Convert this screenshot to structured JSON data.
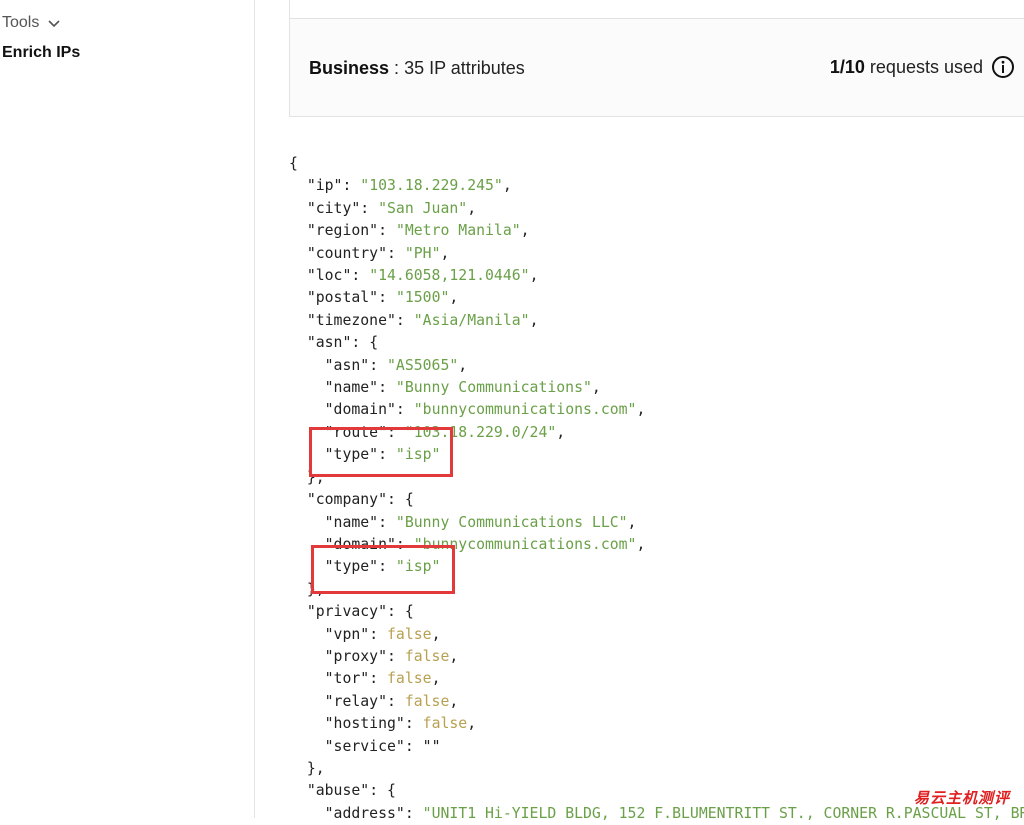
{
  "sidebar": {
    "section_label": "Tools",
    "items": [
      {
        "label": "Enrich IPs"
      }
    ]
  },
  "plan": {
    "tier": "Business",
    "separator": " : ",
    "attributes": "35 IP attributes",
    "requests_used_count": "1/10",
    "requests_used_label": "requests used"
  },
  "json_lines": [
    [
      [
        "p",
        "{"
      ]
    ],
    [
      [
        "p",
        "  "
      ],
      [
        "k",
        "\"ip\""
      ],
      [
        "p",
        ": "
      ],
      [
        "s",
        "\"103.18.229.245\""
      ],
      [
        "p",
        ","
      ]
    ],
    [
      [
        "p",
        "  "
      ],
      [
        "k",
        "\"city\""
      ],
      [
        "p",
        ": "
      ],
      [
        "s",
        "\"San Juan\""
      ],
      [
        "p",
        ","
      ]
    ],
    [
      [
        "p",
        "  "
      ],
      [
        "k",
        "\"region\""
      ],
      [
        "p",
        ": "
      ],
      [
        "s",
        "\"Metro Manila\""
      ],
      [
        "p",
        ","
      ]
    ],
    [
      [
        "p",
        "  "
      ],
      [
        "k",
        "\"country\""
      ],
      [
        "p",
        ": "
      ],
      [
        "s",
        "\"PH\""
      ],
      [
        "p",
        ","
      ]
    ],
    [
      [
        "p",
        "  "
      ],
      [
        "k",
        "\"loc\""
      ],
      [
        "p",
        ": "
      ],
      [
        "s",
        "\"14.6058,121.0446\""
      ],
      [
        "p",
        ","
      ]
    ],
    [
      [
        "p",
        "  "
      ],
      [
        "k",
        "\"postal\""
      ],
      [
        "p",
        ": "
      ],
      [
        "s",
        "\"1500\""
      ],
      [
        "p",
        ","
      ]
    ],
    [
      [
        "p",
        "  "
      ],
      [
        "k",
        "\"timezone\""
      ],
      [
        "p",
        ": "
      ],
      [
        "s",
        "\"Asia/Manila\""
      ],
      [
        "p",
        ","
      ]
    ],
    [
      [
        "p",
        "  "
      ],
      [
        "k",
        "\"asn\""
      ],
      [
        "p",
        ": {"
      ]
    ],
    [
      [
        "p",
        "    "
      ],
      [
        "k",
        "\"asn\""
      ],
      [
        "p",
        ": "
      ],
      [
        "s",
        "\"AS5065\""
      ],
      [
        "p",
        ","
      ]
    ],
    [
      [
        "p",
        "    "
      ],
      [
        "k",
        "\"name\""
      ],
      [
        "p",
        ": "
      ],
      [
        "s",
        "\"Bunny Communications\""
      ],
      [
        "p",
        ","
      ]
    ],
    [
      [
        "p",
        "    "
      ],
      [
        "k",
        "\"domain\""
      ],
      [
        "p",
        ": "
      ],
      [
        "s",
        "\"bunnycommunications.com\""
      ],
      [
        "p",
        ","
      ]
    ],
    [
      [
        "p",
        "    "
      ],
      [
        "k",
        "\"route\""
      ],
      [
        "p",
        ": "
      ],
      [
        "s",
        "\"103.18.229.0/24\""
      ],
      [
        "p",
        ","
      ]
    ],
    [
      [
        "p",
        "    "
      ],
      [
        "k",
        "\"type\""
      ],
      [
        "p",
        ": "
      ],
      [
        "s",
        "\"isp\""
      ]
    ],
    [
      [
        "p",
        "  },"
      ]
    ],
    [
      [
        "p",
        "  "
      ],
      [
        "k",
        "\"company\""
      ],
      [
        "p",
        ": {"
      ]
    ],
    [
      [
        "p",
        "    "
      ],
      [
        "k",
        "\"name\""
      ],
      [
        "p",
        ": "
      ],
      [
        "s",
        "\"Bunny Communications LLC\""
      ],
      [
        "p",
        ","
      ]
    ],
    [
      [
        "p",
        "    "
      ],
      [
        "k",
        "\"domain\""
      ],
      [
        "p",
        ": "
      ],
      [
        "s",
        "\"bunnycommunications.com\""
      ],
      [
        "p",
        ","
      ]
    ],
    [
      [
        "p",
        "    "
      ],
      [
        "k",
        "\"type\""
      ],
      [
        "p",
        ": "
      ],
      [
        "s",
        "\"isp\""
      ]
    ],
    [
      [
        "p",
        "  },"
      ]
    ],
    [
      [
        "p",
        "  "
      ],
      [
        "k",
        "\"privacy\""
      ],
      [
        "p",
        ": {"
      ]
    ],
    [
      [
        "p",
        "    "
      ],
      [
        "k",
        "\"vpn\""
      ],
      [
        "p",
        ": "
      ],
      [
        "b",
        "false"
      ],
      [
        "p",
        ","
      ]
    ],
    [
      [
        "p",
        "    "
      ],
      [
        "k",
        "\"proxy\""
      ],
      [
        "p",
        ": "
      ],
      [
        "b",
        "false"
      ],
      [
        "p",
        ","
      ]
    ],
    [
      [
        "p",
        "    "
      ],
      [
        "k",
        "\"tor\""
      ],
      [
        "p",
        ": "
      ],
      [
        "b",
        "false"
      ],
      [
        "p",
        ","
      ]
    ],
    [
      [
        "p",
        "    "
      ],
      [
        "k",
        "\"relay\""
      ],
      [
        "p",
        ": "
      ],
      [
        "b",
        "false"
      ],
      [
        "p",
        ","
      ]
    ],
    [
      [
        "p",
        "    "
      ],
      [
        "k",
        "\"hosting\""
      ],
      [
        "p",
        ": "
      ],
      [
        "b",
        "false"
      ],
      [
        "p",
        ","
      ]
    ],
    [
      [
        "p",
        "    "
      ],
      [
        "k",
        "\"service\""
      ],
      [
        "p",
        ": "
      ],
      [
        "p",
        "\"\""
      ]
    ],
    [
      [
        "p",
        "  },"
      ]
    ],
    [
      [
        "p",
        "  "
      ],
      [
        "k",
        "\"abuse\""
      ],
      [
        "p",
        ": {"
      ]
    ],
    [
      [
        "p",
        "    "
      ],
      [
        "k",
        "\"address\""
      ],
      [
        "p",
        ": "
      ],
      [
        "s",
        "\"UNIT1 Hi-YIELD BLDG, 152 F.BLUMENTRITT ST., CORNER R.PASCUAL ST, BR"
      ]
    ]
  ],
  "watermark": "易云主机测评",
  "colors": {
    "string": "#6aa048",
    "boolean": "#b8a050",
    "highlight": "#e23a3a"
  },
  "icons": [
    "chevron-down-icon",
    "info-icon"
  ]
}
